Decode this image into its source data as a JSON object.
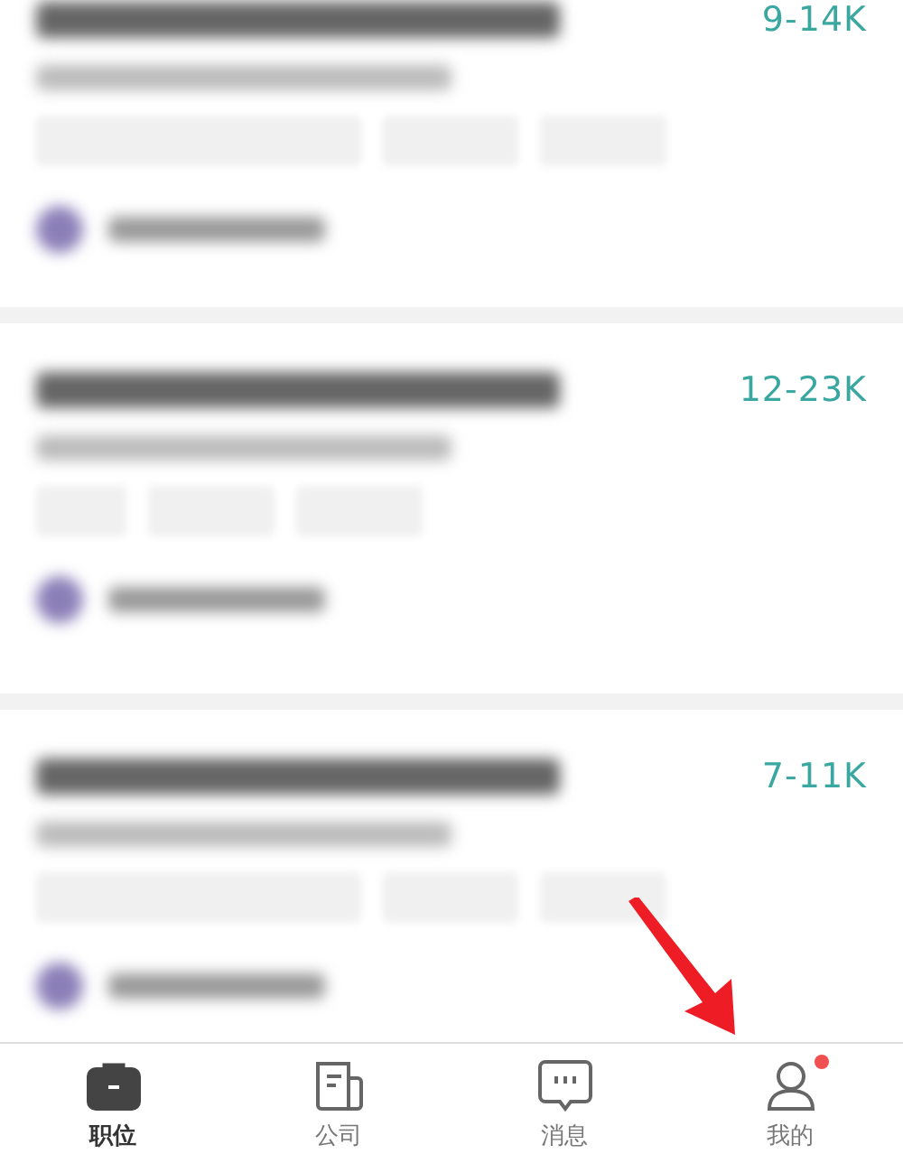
{
  "jobs": [
    {
      "salary": "9-14K"
    },
    {
      "salary": "12-23K"
    },
    {
      "salary": "7-11K"
    }
  ],
  "tab_bar": [
    {
      "label": "职位",
      "kind": "briefcase",
      "selected": true,
      "badge": false
    },
    {
      "label": "公司",
      "kind": "document",
      "selected": false,
      "badge": false
    },
    {
      "label": "消息",
      "kind": "chat",
      "selected": false,
      "badge": false
    },
    {
      "label": "我的",
      "kind": "person",
      "selected": false,
      "badge": true
    }
  ]
}
